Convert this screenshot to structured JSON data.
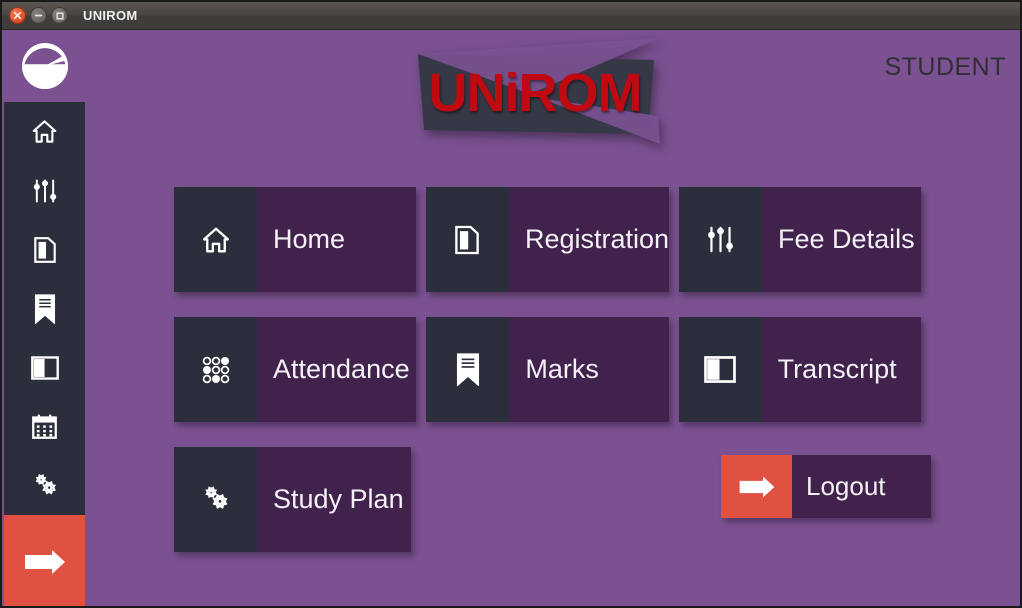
{
  "window": {
    "title": "UNIROM",
    "controls": [
      {
        "name": "close",
        "label": "Close"
      },
      {
        "name": "minimize",
        "label": "Minimize"
      },
      {
        "name": "maximize",
        "label": "Maximize"
      }
    ]
  },
  "header": {
    "brand": "UNiROM",
    "role": "STUDENT"
  },
  "sidebar": {
    "logo_icon": "gauge-icon",
    "items": [
      {
        "icon": "home-icon",
        "label": "Home"
      },
      {
        "icon": "sliders-icon",
        "label": "Fee Details"
      },
      {
        "icon": "page-icon",
        "label": "Registration"
      },
      {
        "icon": "bookmark-icon",
        "label": "Marks"
      },
      {
        "icon": "split-square-icon",
        "label": "Transcript"
      },
      {
        "icon": "calendar-icon",
        "label": "Attendance"
      },
      {
        "icon": "cogs-icon",
        "label": "Study Plan"
      }
    ],
    "logout": {
      "icon": "logout-arrow-icon",
      "label": "Logout"
    }
  },
  "main": {
    "tiles": [
      {
        "label": "Home",
        "icon": "home-icon"
      },
      {
        "label": "Registration",
        "icon": "page-icon"
      },
      {
        "label": "Fee Details",
        "icon": "sliders-icon"
      },
      {
        "label": "Attendance",
        "icon": "dot-grid-icon"
      },
      {
        "label": "Marks",
        "icon": "bookmark-icon"
      },
      {
        "label": "Transcript",
        "icon": "split-square-icon"
      },
      {
        "label": "Study Plan",
        "icon": "cogs-icon"
      }
    ],
    "logout_button": {
      "label": "Logout",
      "icon": "logout-arrow-icon"
    }
  },
  "colors": {
    "background": "#7b5191",
    "panel_dark": "#2b2e3b",
    "tile_label": "#40224c",
    "accent_red": "#e05141",
    "brand_red": "#c00a12",
    "titlebar": "#49463f"
  }
}
